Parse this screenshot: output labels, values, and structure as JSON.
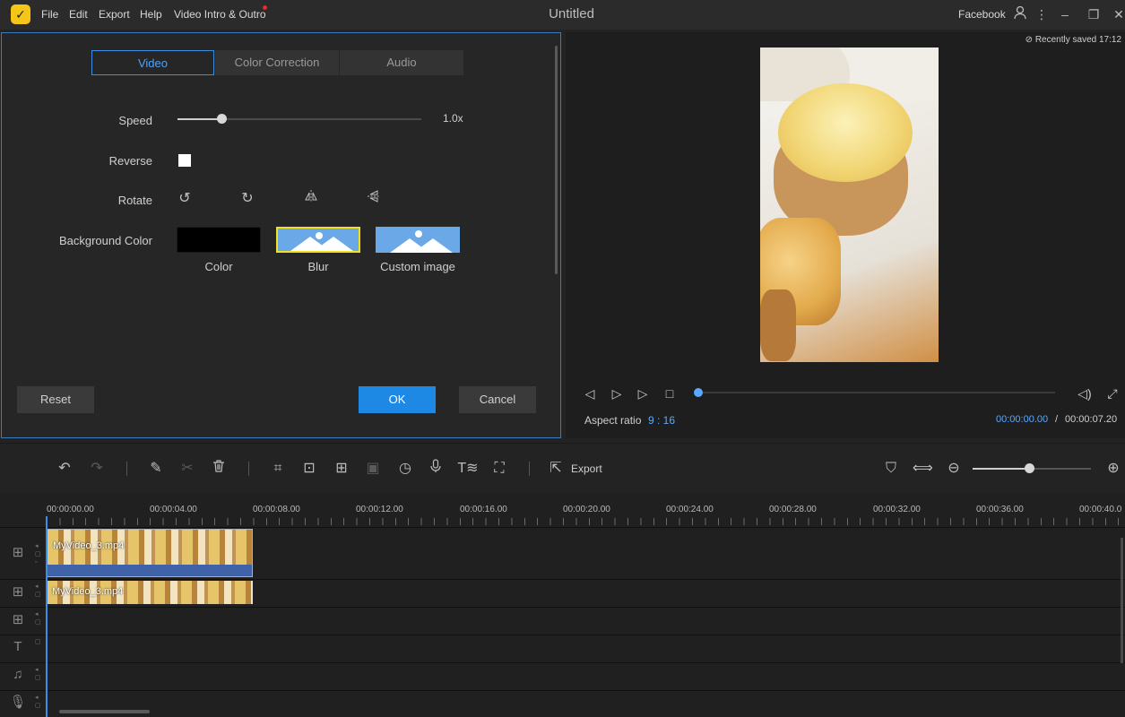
{
  "app": {
    "title": "Untitled",
    "logo_glyph": "✓",
    "menu": [
      "File",
      "Edit",
      "Export",
      "Help",
      "Video Intro & Outro"
    ],
    "account": "Facebook",
    "icons": {
      "user": "user-icon",
      "more": "more-vertical-icon",
      "minimize": "minimize-icon",
      "restore": "restore-icon",
      "close": "close-icon"
    }
  },
  "edit_panel": {
    "tabs": [
      "Video",
      "Color Correction",
      "Audio"
    ],
    "active_tab": "Video",
    "speed": {
      "label": "Speed",
      "value": "1.0x"
    },
    "reverse": {
      "label": "Reverse",
      "checked": false
    },
    "rotate": {
      "label": "Rotate",
      "icons": [
        "rotate-left-icon",
        "rotate-right-icon",
        "flip-horizontal-icon",
        "flip-vertical-icon"
      ]
    },
    "background": {
      "label": "Background Color",
      "options": [
        "Color",
        "Blur",
        "Custom image"
      ],
      "selected": "Blur"
    },
    "buttons": {
      "reset": "Reset",
      "ok": "OK",
      "cancel": "Cancel"
    }
  },
  "preview": {
    "saved": "Recently saved 17:12",
    "aspect_label": "Aspect ratio",
    "aspect_value": "9 : 16",
    "time_current": "00:00:00.00",
    "time_separator": "/",
    "time_total": "00:00:07.20",
    "progress": 0
  },
  "toolbar": {
    "export_label": "Export",
    "zoom_level": 0.48
  },
  "timeline": {
    "ruler": [
      "00:00:00.00",
      "00:00:04.00",
      "00:00:08.00",
      "00:00:12.00",
      "00:00:16.00",
      "00:00:20.00",
      "00:00:24.00",
      "00:00:28.00",
      "00:00:32.00",
      "00:00:36.00",
      "00:00:40.0"
    ],
    "clips": [
      {
        "name": "MyVideo_3.mp4"
      },
      {
        "name": "MyVideo_3.mp4"
      }
    ]
  }
}
